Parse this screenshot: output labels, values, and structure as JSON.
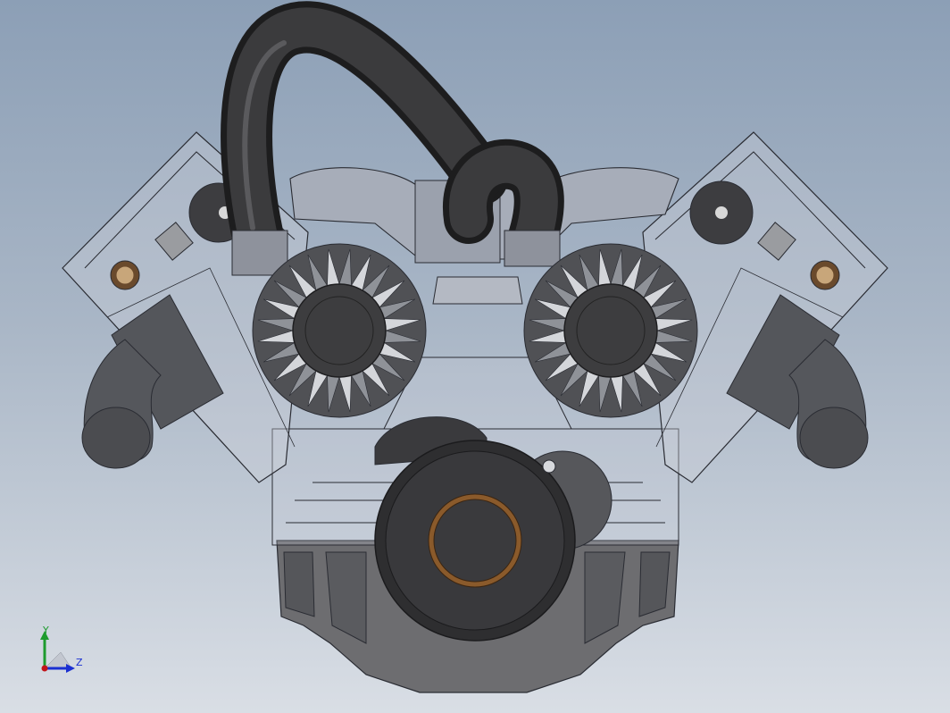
{
  "viewport": {
    "background_top": "#8c9fb6",
    "background_bottom": "#d9dee5"
  },
  "model": {
    "subject": "v-engine-assembly",
    "display_mode": "shaded-with-edges-transparent-block"
  },
  "triad": {
    "y_label": "Y",
    "z_label": "Z",
    "y_color": "#1e9b2e",
    "z_color": "#1a2fd1",
    "origin_color": "#c2141a"
  },
  "colors": {
    "hose": "#2b2b2b",
    "blower": "#b9bcc2",
    "cap": "#3d3d3f",
    "bearing": "#8a5a2b",
    "block_edge": "#2a2c33"
  }
}
